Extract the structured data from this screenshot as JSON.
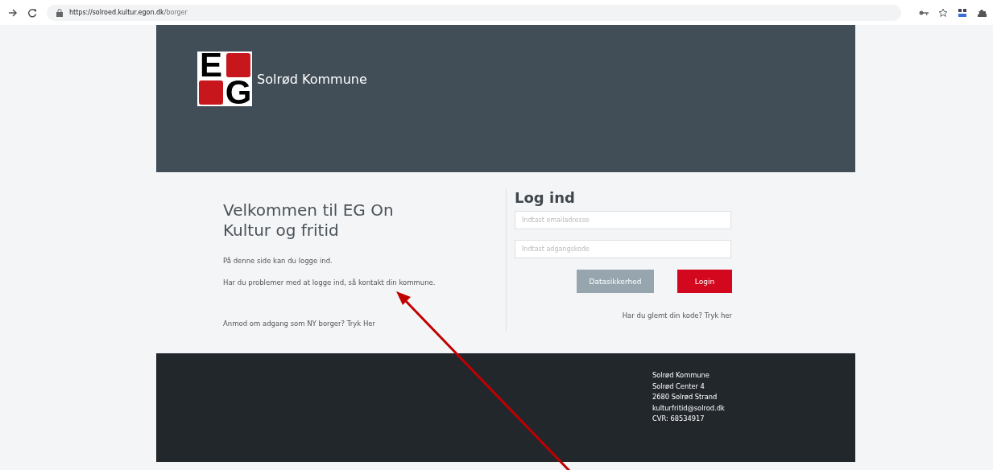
{
  "browser": {
    "url_host": "https://solroed.kultur.egon.dk",
    "url_path": "/borger"
  },
  "header": {
    "logo_letters": [
      "E",
      "G"
    ],
    "title": "Solrød Kommune"
  },
  "welcome": {
    "heading": "Velkommen til EG On Kultur og fritid",
    "paragraphs": [
      "På denne side kan du logge ind.",
      "Har du problemer med at logge ind, så kontakt din kommune."
    ],
    "request_link": "Anmod om adgang som NY borger? Tryk Her"
  },
  "login": {
    "heading": "Log ind",
    "email": {
      "placeholder": "Indtast emailadresse"
    },
    "password": {
      "placeholder": "Indtast adgangskode"
    },
    "buttons": [
      {
        "kind": "secondary",
        "label": "Datasikkerhed"
      },
      {
        "kind": "primary",
        "label": "Login"
      }
    ],
    "forgot_link": "Har du glemt din kode? Tryk her"
  },
  "footer": {
    "lines": [
      "Solrød Kommune",
      "Solrød Center 4",
      "2680 Solrød Strand",
      "kulturfritid@solrod.dk",
      "CVR: 68534917"
    ]
  },
  "annotation": {
    "kind": "arrow"
  }
}
